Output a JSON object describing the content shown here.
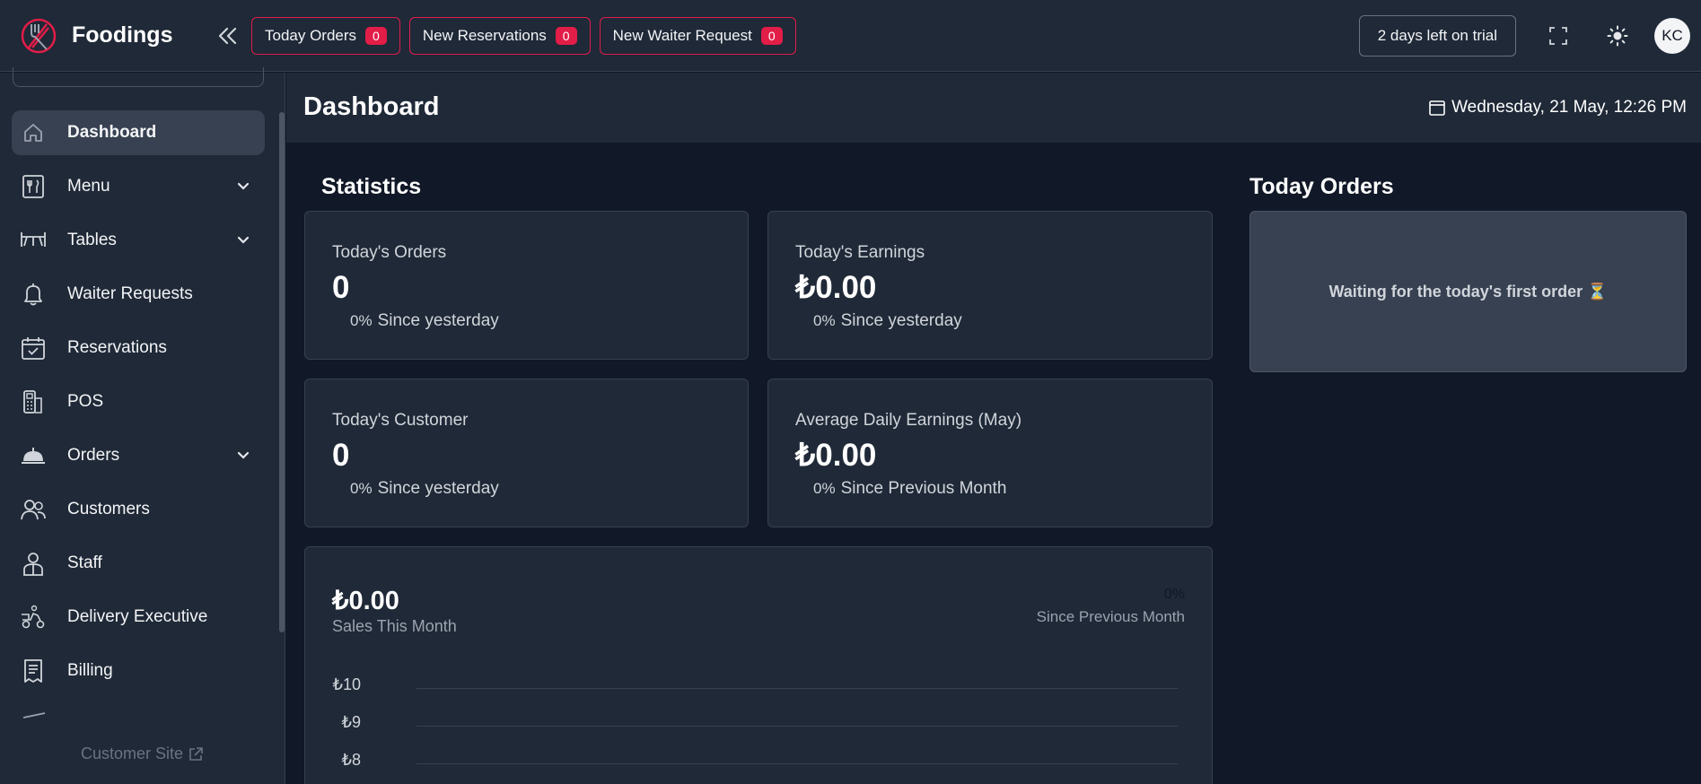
{
  "app": {
    "name": "Foodings"
  },
  "topbar": {
    "pills": [
      {
        "label": "Today Orders",
        "count": "0"
      },
      {
        "label": "New Reservations",
        "count": "0"
      },
      {
        "label": "New Waiter Request",
        "count": "0"
      }
    ],
    "trial_label": "2 days left on trial",
    "avatar_initials": "KC"
  },
  "sidebar": {
    "items": [
      {
        "label": "Dashboard",
        "icon": "home-icon",
        "active": true
      },
      {
        "label": "Menu",
        "icon": "menu-book-icon",
        "expandable": true
      },
      {
        "label": "Tables",
        "icon": "table-icon",
        "expandable": true
      },
      {
        "label": "Waiter Requests",
        "icon": "bell-icon"
      },
      {
        "label": "Reservations",
        "icon": "calendar-check-icon"
      },
      {
        "label": "POS",
        "icon": "pos-terminal-icon"
      },
      {
        "label": "Orders",
        "icon": "cloche-icon",
        "expandable": true
      },
      {
        "label": "Customers",
        "icon": "users-icon"
      },
      {
        "label": "Staff",
        "icon": "staff-icon"
      },
      {
        "label": "Delivery Executive",
        "icon": "delivery-scooter-icon"
      },
      {
        "label": "Billing",
        "icon": "receipt-icon"
      }
    ],
    "customer_site": "Customer Site"
  },
  "page": {
    "title": "Dashboard",
    "date": "Wednesday, 21 May, 12:26 PM"
  },
  "statistics": {
    "title": "Statistics",
    "cards": [
      {
        "label": "Today's Orders",
        "value": "0",
        "pct": "0%",
        "since": "Since yesterday"
      },
      {
        "label": "Today's Earnings",
        "value": "₺0.00",
        "pct": "0%",
        "since": "Since yesterday"
      },
      {
        "label": "Today's Customer",
        "value": "0",
        "pct": "0%",
        "since": "Since yesterday"
      },
      {
        "label": "Average Daily Earnings (May)",
        "value": "₺0.00",
        "pct": "0%",
        "since": "Since Previous Month"
      }
    ],
    "sales": {
      "value": "₺0.00",
      "label": "Sales This Month",
      "pct": "0%",
      "since": "Since Previous Month",
      "ticks": [
        "₺10",
        "₺9",
        "₺8"
      ]
    }
  },
  "today_orders": {
    "title": "Today Orders",
    "empty_message": "Waiting for the today's first order ⏳"
  },
  "colors": {
    "accent": "#e11d48",
    "background": "#111827",
    "panel": "#1f2937"
  }
}
